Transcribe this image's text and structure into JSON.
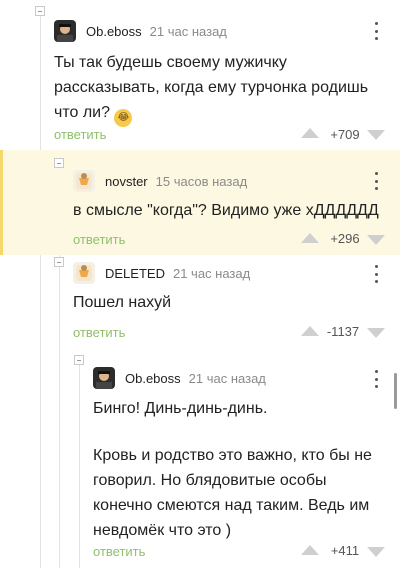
{
  "comments": [
    {
      "username": "Ob.eboss",
      "time": "21 час назад",
      "lines": [
        "Ты так будешь своему мужичку",
        "рассказывать, когда ему турчонка родишь",
        "что ли?"
      ],
      "emoji": "laughing-tears-emoji",
      "reply_label": "ответить",
      "rating": "+709"
    },
    {
      "username": "novster",
      "time": "15 часов назад",
      "lines": [
        "в смысле \"когда\"? Видимо уже хДДДДДД"
      ],
      "reply_label": "ответить",
      "rating": "+296"
    },
    {
      "username": "DELETED",
      "time": "21 час назад",
      "lines": [
        "Пошел нахуй"
      ],
      "reply_label": "ответить",
      "rating": "-1137"
    },
    {
      "username": "Ob.eboss",
      "time": "21 час назад",
      "lines": [
        "Бинго! Динь-динь-динь.",
        "",
        "Кровь и родство это важно, кто бы не",
        "говорил. Но блядовитые особы",
        "конечно смеются над таким. Ведь им",
        "невдомёк что это )"
      ],
      "reply_label": "ответить",
      "rating": "+411"
    }
  ],
  "colors": {
    "reply": "#8fbf6c",
    "highlight": "#fcf8e2",
    "highlight_bar": "#f3d96b"
  }
}
